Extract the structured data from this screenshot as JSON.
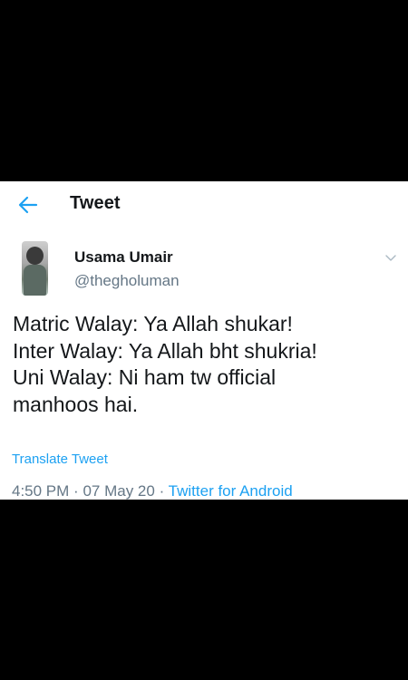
{
  "header": {
    "title": "Tweet",
    "back_icon": "arrow-left-icon"
  },
  "colors": {
    "accent": "#1DA1F2",
    "text": "#14171a",
    "muted": "#657786"
  },
  "tweet": {
    "author_name": "Usama Umair",
    "author_handle": "@thegholuman",
    "lines": [
      "Matric Walay: Ya Allah shukar!",
      "Inter Walay: Ya Allah bht shukria!",
      "Uni Walay: Ni ham tw official",
      "manhoos hai."
    ],
    "translate_label": "Translate Tweet",
    "time": "4:50 PM",
    "separator": "·",
    "date": "07 May 20",
    "source": "Twitter for Android"
  }
}
